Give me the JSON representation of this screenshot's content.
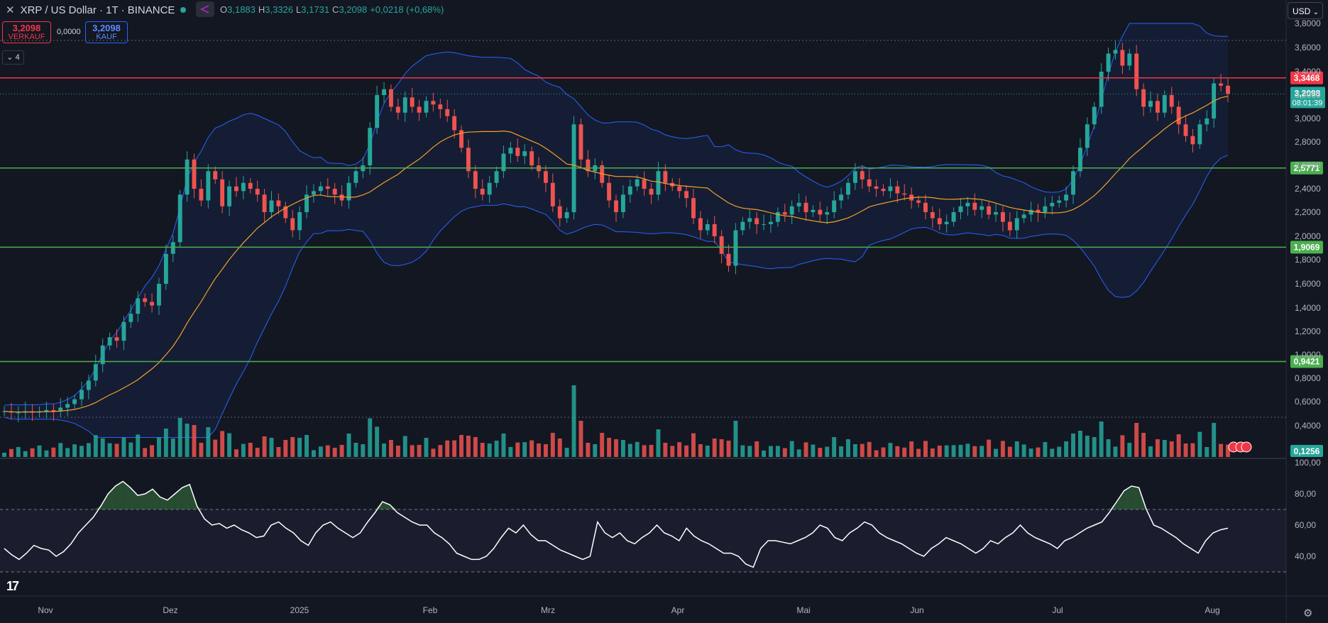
{
  "header": {
    "symbol": "XRP / US Dollar · 1T · BINANCE",
    "ohlc": [
      {
        "k": "O",
        "v": "3,1883"
      },
      {
        "k": "H",
        "v": "3,3326"
      },
      {
        "k": "L",
        "v": "3,1731"
      },
      {
        "k": "C",
        "v": "3,2098"
      }
    ],
    "change": "+0,0218 (+0,68%)",
    "sell_price": "3,2098",
    "sell_label": "VERKAUF",
    "spread": "0,0000",
    "buy_price": "3,2098",
    "buy_label": "KAUF",
    "indicator_count": "4",
    "currency": "USD"
  },
  "colors": {
    "background": "#131722",
    "up": "#26a69a",
    "down": "#ef5350",
    "bollinger": "#2962ff",
    "sma": "#f59f2b",
    "level_green": "#4caf50",
    "level_red": "#f23645",
    "rsi": "#ffffff"
  },
  "chart_data": {
    "type": "candlestick",
    "price_axis_ticks": [
      "3,8000",
      "3,6000",
      "3,4000",
      "3,2000",
      "3,0000",
      "2,8000",
      "2,6000",
      "2,4000",
      "2,2000",
      "2,0000",
      "1,8000",
      "1,6000",
      "1,4000",
      "1,2000",
      "1,0000",
      "0,8000",
      "0,6000",
      "0,4000"
    ],
    "rsi_axis_ticks": [
      "100,00",
      "80,00",
      "60,00",
      "40,00"
    ],
    "x_labels": [
      "Nov",
      "Dez",
      "2025",
      "Feb",
      "Mrz",
      "Apr",
      "Mai",
      "Jun",
      "Jul",
      "Aug"
    ],
    "price_range": [
      0.35,
      3.85
    ],
    "horizontal_levels": [
      {
        "label": "3,3468",
        "value": 3.3468,
        "color": "#f23645"
      },
      {
        "label": "2,5771",
        "value": 2.5771,
        "color": "#4caf50"
      },
      {
        "label": "1,9069",
        "value": 1.9069,
        "color": "#4caf50"
      },
      {
        "label": "0,9421",
        "value": 0.9421,
        "color": "#4caf50"
      }
    ],
    "current_price": {
      "label": "3,2098",
      "value": 3.2098,
      "countdown": "08:01:39"
    },
    "volume_label": "0,1256",
    "close_series": [
      0.52,
      0.51,
      0.51,
      0.52,
      0.51,
      0.52,
      0.53,
      0.52,
      0.55,
      0.58,
      0.62,
      0.7,
      0.78,
      0.92,
      1.08,
      1.15,
      1.12,
      1.28,
      1.35,
      1.48,
      1.45,
      1.42,
      1.6,
      1.85,
      1.95,
      2.35,
      2.65,
      2.4,
      2.3,
      2.55,
      2.48,
      2.25,
      2.42,
      2.38,
      2.45,
      2.4,
      2.35,
      2.2,
      2.3,
      2.25,
      2.15,
      2.05,
      2.2,
      2.35,
      2.38,
      2.42,
      2.4,
      2.35,
      2.3,
      2.45,
      2.55,
      2.6,
      2.92,
      3.2,
      3.25,
      3.1,
      3.05,
      3.18,
      3.1,
      3.05,
      3.15,
      3.12,
      3.08,
      3.02,
      2.9,
      2.75,
      2.55,
      2.4,
      2.35,
      2.45,
      2.55,
      2.7,
      2.75,
      2.68,
      2.72,
      2.6,
      2.55,
      2.45,
      2.25,
      2.15,
      2.2,
      2.95,
      2.65,
      2.55,
      2.6,
      2.45,
      2.3,
      2.2,
      2.35,
      2.42,
      2.48,
      2.4,
      2.35,
      2.55,
      2.45,
      2.42,
      2.38,
      2.32,
      2.15,
      2.05,
      2.1,
      2.0,
      1.85,
      1.75,
      2.05,
      2.12,
      2.15,
      2.1,
      2.1,
      2.12,
      2.2,
      2.18,
      2.25,
      2.28,
      2.2,
      2.22,
      2.18,
      2.2,
      2.3,
      2.35,
      2.45,
      2.55,
      2.48,
      2.42,
      2.4,
      2.38,
      2.42,
      2.36,
      2.35,
      2.3,
      2.28,
      2.2,
      2.15,
      2.1,
      2.12,
      2.2,
      2.25,
      2.28,
      2.22,
      2.25,
      2.18,
      2.2,
      2.12,
      2.05,
      2.15,
      2.18,
      2.22,
      2.2,
      2.25,
      2.28,
      2.3,
      2.35,
      2.55,
      2.75,
      2.95,
      3.1,
      3.4,
      3.55,
      3.58,
      3.45,
      3.55,
      3.25,
      3.1,
      3.15,
      3.05,
      3.2,
      3.1,
      2.95,
      2.85,
      2.78,
      2.95,
      3.0,
      3.3,
      3.28,
      3.21
    ],
    "sma_series_note": "20-period moving average derived from close_series",
    "bollinger_note": "upper/lower bands at ±2 standard deviations",
    "rsi_series": [
      45,
      41,
      38,
      42,
      47,
      45,
      44,
      40,
      43,
      48,
      55,
      60,
      65,
      72,
      80,
      85,
      88,
      84,
      79,
      80,
      83,
      78,
      76,
      80,
      84,
      86,
      72,
      64,
      60,
      61,
      58,
      60,
      57,
      55,
      52,
      53,
      60,
      62,
      58,
      55,
      50,
      47,
      55,
      60,
      62,
      58,
      55,
      52,
      55,
      62,
      68,
      75,
      73,
      68,
      65,
      62,
      60,
      60,
      55,
      52,
      48,
      42,
      40,
      38,
      38,
      40,
      45,
      52,
      58,
      55,
      60,
      54,
      50,
      50,
      47,
      44,
      42,
      40,
      38,
      40,
      62,
      55,
      52,
      55,
      50,
      48,
      52,
      55,
      60,
      55,
      53,
      50,
      58,
      53,
      50,
      48,
      45,
      42,
      42,
      40,
      35,
      33,
      45,
      50,
      50,
      49,
      48,
      50,
      52,
      55,
      60,
      58,
      52,
      50,
      55,
      58,
      62,
      60,
      55,
      52,
      50,
      48,
      45,
      42,
      40,
      45,
      48,
      52,
      50,
      48,
      45,
      42,
      45,
      50,
      48,
      52,
      55,
      60,
      55,
      52,
      50,
      48,
      45,
      50,
      52,
      55,
      58,
      60,
      62,
      68,
      75,
      82,
      85,
      84,
      70,
      60,
      58,
      55,
      52,
      48,
      45,
      42,
      50,
      55,
      57,
      58
    ]
  },
  "panes": {
    "rsi_top": "100,00"
  }
}
